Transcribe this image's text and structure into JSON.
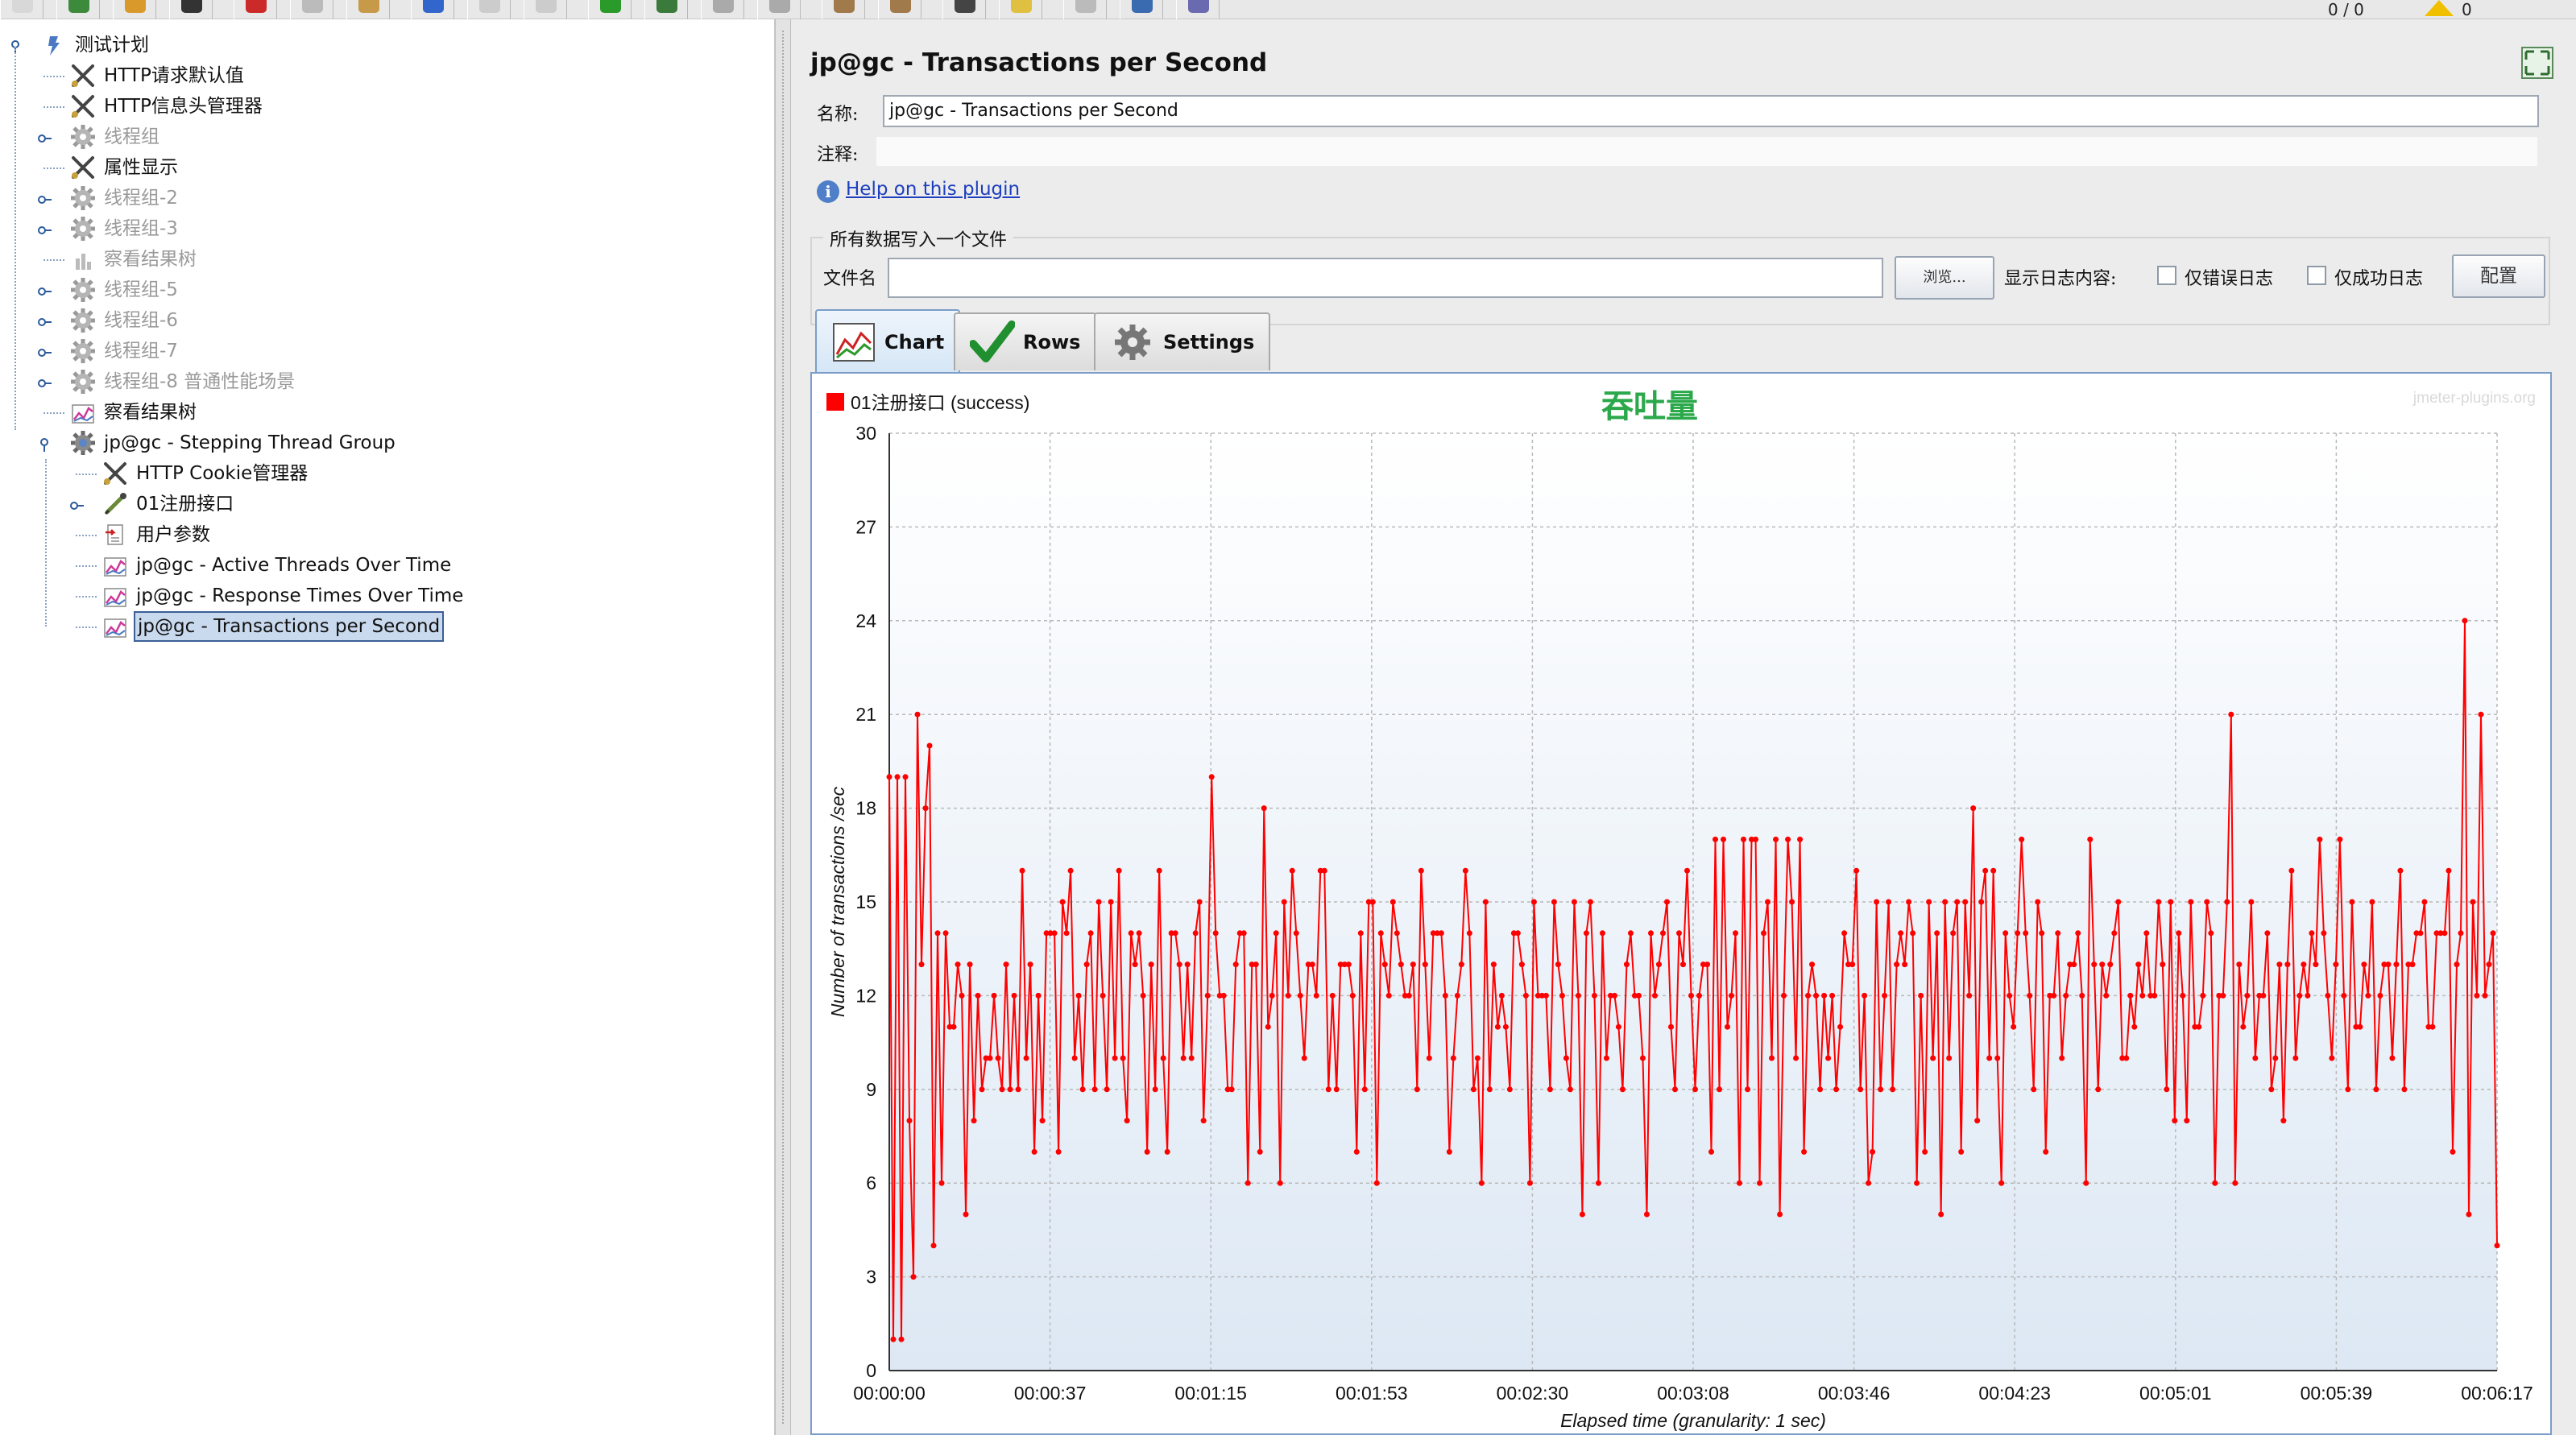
{
  "status": {
    "value": "0 / 0",
    "warn_count": "0"
  },
  "tree": {
    "items": [
      {
        "label": "测试计划",
        "icon": "test-plan-icon",
        "level": 0,
        "disabled": false,
        "expanded": true,
        "expander": "minus"
      },
      {
        "label": "HTTP请求默认值",
        "icon": "wrench-icon",
        "level": 1,
        "disabled": false
      },
      {
        "label": "HTTP信息头管理器",
        "icon": "wrench-icon",
        "level": 1,
        "disabled": false
      },
      {
        "label": "线程组",
        "icon": "gear-icon",
        "level": 1,
        "disabled": true,
        "expander": "plus"
      },
      {
        "label": "属性显示",
        "icon": "wrench-icon",
        "level": 1,
        "disabled": false
      },
      {
        "label": "线程组-2",
        "icon": "gear-icon",
        "level": 1,
        "disabled": true,
        "expander": "plus"
      },
      {
        "label": "线程组-3",
        "icon": "gear-icon",
        "level": 1,
        "disabled": true,
        "expander": "plus"
      },
      {
        "label": "察看结果树",
        "icon": "graph-icon",
        "level": 1,
        "disabled": true
      },
      {
        "label": "线程组-5",
        "icon": "gear-icon",
        "level": 1,
        "disabled": true,
        "expander": "plus"
      },
      {
        "label": "线程组-6",
        "icon": "gear-icon",
        "level": 1,
        "disabled": true,
        "expander": "plus"
      },
      {
        "label": "线程组-7",
        "icon": "gear-icon",
        "level": 1,
        "disabled": true,
        "expander": "plus"
      },
      {
        "label": "线程组-8 普通性能场景",
        "icon": "gear-icon",
        "level": 1,
        "disabled": true,
        "expander": "plus"
      },
      {
        "label": "察看结果树",
        "icon": "graph-icon",
        "level": 1,
        "disabled": false
      },
      {
        "label": "jp@gc - Stepping Thread Group",
        "icon": "gear-icon",
        "level": 1,
        "disabled": false,
        "expander": "minus"
      },
      {
        "label": "HTTP Cookie管理器",
        "icon": "wrench-icon",
        "level": 2,
        "disabled": false
      },
      {
        "label": "01注册接口",
        "icon": "pipette-icon",
        "level": 2,
        "disabled": false,
        "expander": "plus"
      },
      {
        "label": "用户参数",
        "icon": "document-icon",
        "level": 2,
        "disabled": false
      },
      {
        "label": "jp@gc - Active Threads Over Time",
        "icon": "graph-icon",
        "level": 2,
        "disabled": false
      },
      {
        "label": "jp@gc - Response Times Over Time",
        "icon": "graph-icon",
        "level": 2,
        "disabled": false
      },
      {
        "label": "jp@gc - Transactions per Second",
        "icon": "graph-icon",
        "level": 2,
        "disabled": false,
        "selected": true
      }
    ]
  },
  "panel": {
    "title": "jp@gc - Transactions per Second",
    "name_label": "名称:",
    "name_value": "jp@gc - Transactions per Second",
    "comment_label": "注释:",
    "comment_value": "",
    "help_link": "Help on this plugin",
    "file_group_title": "所有数据写入一个文件",
    "filename_label": "文件名",
    "filename_value": "",
    "browse_label": "浏览...",
    "log_label": "显示日志内容:",
    "errors_only_label": "仅错误日志",
    "success_only_label": "仅成功日志",
    "configure_label": "配置"
  },
  "tabs": [
    {
      "label": "Chart",
      "icon": "chart-icon",
      "active": true
    },
    {
      "label": "Rows",
      "icon": "checkmark-icon",
      "active": false
    },
    {
      "label": "Settings",
      "icon": "gear-icon",
      "active": false
    }
  ],
  "chart_data": {
    "type": "line",
    "annotation": "吞吐量",
    "watermark": "jmeter-plugins.org",
    "legend_position": "top-left",
    "xlabel": "Elapsed time (granularity: 1 sec)",
    "ylabel": "Number of transactions /sec",
    "ylim": [
      0,
      30
    ],
    "xlim_seconds": [
      0,
      377
    ],
    "x_tick_labels": [
      "00:00:00",
      "00:00:37",
      "00:01:15",
      "00:01:53",
      "00:02:30",
      "00:03:08",
      "00:03:46",
      "00:04:23",
      "00:05:01",
      "00:05:39",
      "00:06:17"
    ],
    "y_ticks": [
      0,
      3,
      6,
      9,
      12,
      15,
      18,
      21,
      24,
      27,
      30
    ],
    "grid": true,
    "series": [
      {
        "name": "01注册接口 (success)",
        "color": "#ff0000",
        "values": [
          19,
          1,
          19,
          1,
          19,
          8,
          3,
          21,
          13,
          18,
          20,
          4,
          14,
          6,
          14,
          11,
          11,
          13,
          12,
          5,
          13,
          8,
          12,
          9,
          10,
          10,
          12,
          10,
          9,
          13,
          9,
          12,
          9,
          16,
          10,
          13,
          7,
          12,
          8,
          14,
          14,
          14,
          7,
          15,
          14,
          16,
          10,
          12,
          9,
          13,
          14,
          9,
          15,
          12,
          9,
          15,
          10,
          16,
          10,
          8,
          14,
          13,
          14,
          12,
          7,
          13,
          9,
          16,
          10,
          7,
          14,
          14,
          13,
          10,
          13,
          10,
          14,
          15,
          8,
          12,
          19,
          14,
          12,
          12,
          9,
          9,
          13,
          14,
          14,
          6,
          13,
          13,
          7,
          18,
          11,
          12,
          14,
          6,
          15,
          12,
          16,
          14,
          12,
          10,
          13,
          13,
          12,
          16,
          16,
          9,
          12,
          9,
          13,
          13,
          13,
          12,
          7,
          14,
          9,
          15,
          15,
          6,
          14,
          13,
          12,
          15,
          14,
          13,
          12,
          12,
          13,
          9,
          16,
          13,
          10,
          14,
          14,
          14,
          12,
          7,
          10,
          12,
          13,
          16,
          14,
          9,
          10,
          6,
          15,
          9,
          13,
          11,
          12,
          11,
          9,
          14,
          14,
          13,
          12,
          6,
          15,
          12,
          12,
          12,
          9,
          15,
          13,
          12,
          10,
          9,
          15,
          12,
          5,
          14,
          15,
          12,
          6,
          14,
          10,
          12,
          12,
          11,
          9,
          13,
          14,
          12,
          12,
          10,
          5,
          14,
          12,
          13,
          14,
          15,
          11,
          9,
          14,
          13,
          16,
          12,
          9,
          12,
          13,
          13,
          7,
          17,
          9,
          17,
          11,
          12,
          14,
          6,
          17,
          9,
          17,
          17,
          6,
          14,
          15,
          10,
          17,
          5,
          12,
          17,
          15,
          10,
          17,
          7,
          12,
          13,
          12,
          9,
          12,
          10,
          12,
          9,
          11,
          14,
          13,
          13,
          16,
          9,
          12,
          6,
          7,
          15,
          9,
          12,
          15,
          9,
          13,
          14,
          13,
          15,
          14,
          6,
          12,
          7,
          15,
          10,
          14,
          5,
          15,
          10,
          14,
          15,
          7,
          15,
          12,
          18,
          8,
          15,
          16,
          10,
          16,
          10,
          6,
          14,
          12,
          11,
          14,
          17,
          14,
          12,
          9,
          15,
          14,
          7,
          12,
          12,
          14,
          10,
          12,
          13,
          13,
          14,
          12,
          6,
          17,
          13,
          9,
          13,
          12,
          13,
          14,
          15,
          10,
          10,
          12,
          11,
          13,
          12,
          14,
          12,
          12,
          15,
          13,
          9,
          15,
          8,
          14,
          12,
          8,
          15,
          11,
          11,
          12,
          15,
          14,
          6,
          12,
          12,
          15,
          21,
          6,
          13,
          11,
          12,
          15,
          10,
          12,
          12,
          14,
          9,
          10,
          13,
          8,
          13,
          16,
          10,
          12,
          13,
          12,
          14,
          13,
          17,
          14,
          12,
          10,
          13,
          17,
          12,
          9,
          15,
          11,
          11,
          13,
          12,
          15,
          9,
          12,
          13,
          13,
          10,
          13,
          16,
          9,
          13,
          13,
          14,
          14,
          15,
          11,
          11,
          14,
          14,
          14,
          16,
          7,
          13,
          14,
          24,
          5,
          15,
          12,
          21,
          12,
          13,
          14,
          4
        ]
      }
    ]
  }
}
